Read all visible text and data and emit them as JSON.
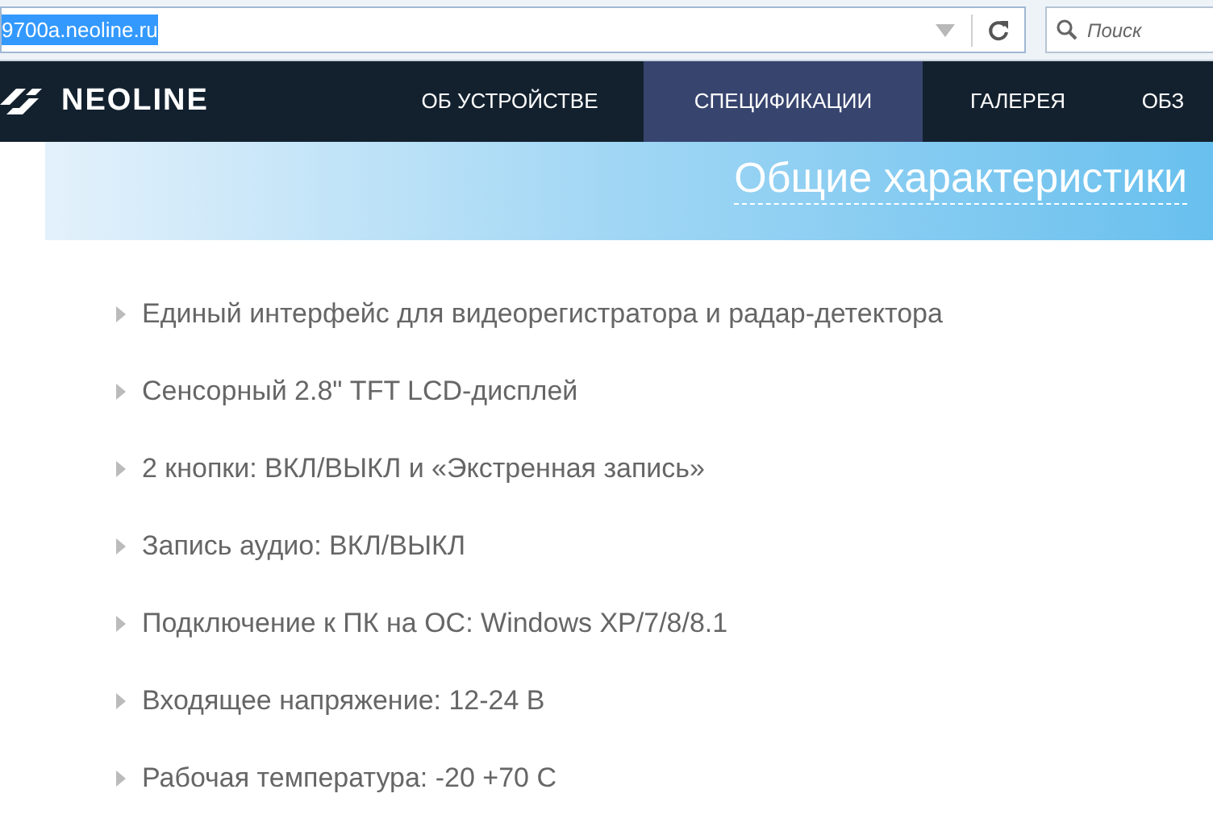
{
  "browser": {
    "url": "9700a.neoline.ru",
    "url_selected": true,
    "search": {
      "placeholder": "Поиск"
    }
  },
  "site": {
    "logo": "NEOLINE",
    "nav": [
      {
        "label": "ОБ УСТРОЙСТВЕ",
        "selected": false
      },
      {
        "label": "СПЕЦИФИКАЦИИ",
        "selected": true
      },
      {
        "label": "ГАЛЕРЕЯ",
        "selected": false
      },
      {
        "label": "ОБЗ",
        "selected": false
      }
    ]
  },
  "section_title": "Общие характеристики",
  "features": [
    "Единый интерфейс для видеорегистратора и радар-детектора",
    "Сенсорный 2.8\" TFT LCD-дисплей",
    "2 кнопки: ВКЛ/ВЫКЛ и «Экстренная запись»",
    "Запись аудио: ВКЛ/ВЫКЛ",
    "Подключение к ПК на ОС: Windows XP/7/8/8.1",
    "Входящее напряжение: 12-24 В",
    "Рабочая температура: -20 +70 С"
  ]
}
